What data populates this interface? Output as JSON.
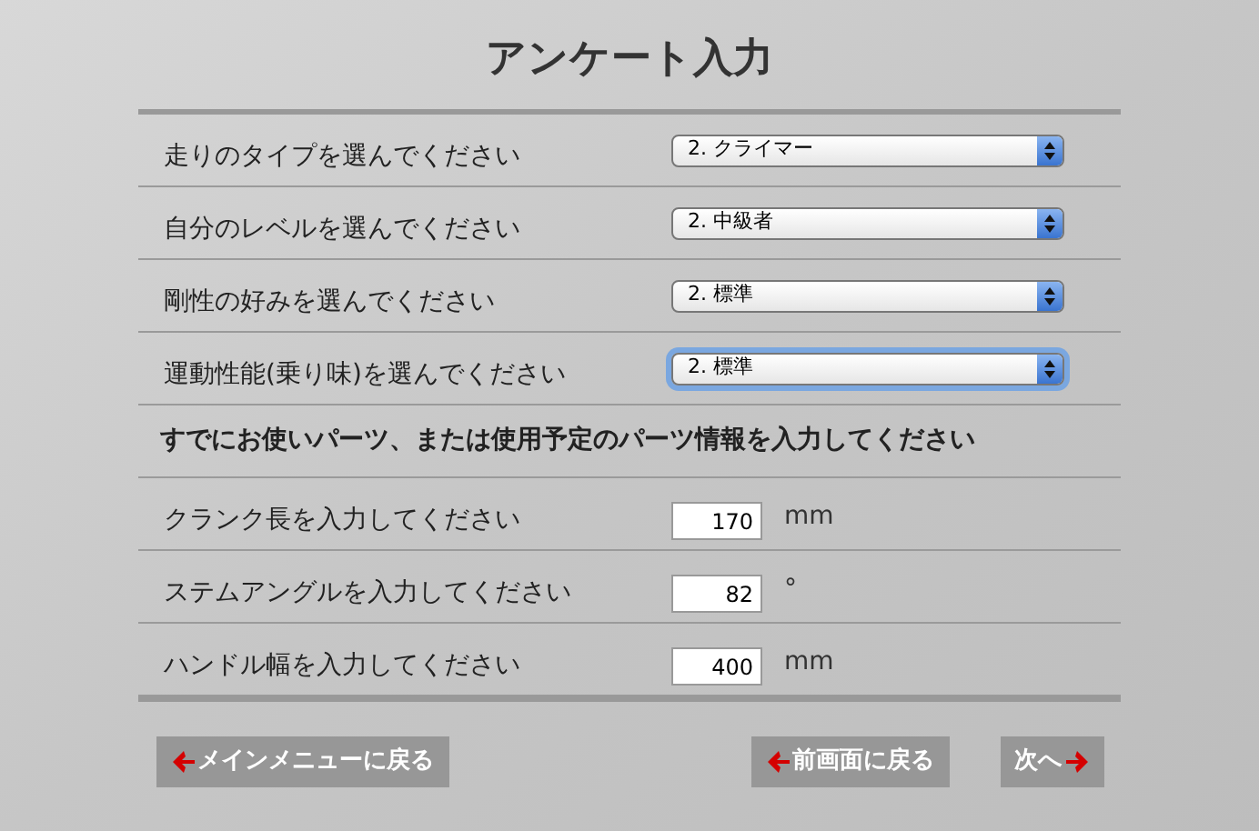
{
  "title": "アンケート入力",
  "rows": [
    {
      "kind": "select",
      "label": "走りのタイプを選んでください",
      "value": "2. クライマー",
      "focused": false
    },
    {
      "kind": "select",
      "label": "自分のレベルを選んでください",
      "value": "2. 中級者",
      "focused": false
    },
    {
      "kind": "select",
      "label": "剛性の好みを選んでください",
      "value": "2. 標準",
      "focused": false
    },
    {
      "kind": "select",
      "label": "運動性能(乗り味)を選んでください",
      "value": "2. 標準",
      "focused": true
    },
    {
      "kind": "heading",
      "label": "すでにお使いパーツ、または使用予定のパーツ情報を入力してください"
    },
    {
      "kind": "input",
      "label": "クランク長を入力してください",
      "value": "170",
      "unit": "mm"
    },
    {
      "kind": "input",
      "label": "ステムアングルを入力してください",
      "value": "82",
      "unit": "°"
    },
    {
      "kind": "input",
      "label": "ハンドル幅を入力してください",
      "value": "400",
      "unit": "mm"
    }
  ],
  "buttons": [
    {
      "kind": "back",
      "label": "メインメニューに戻る"
    },
    {
      "kind": "back",
      "label": "前画面に戻る"
    },
    {
      "kind": "next",
      "label": "次へ"
    }
  ]
}
